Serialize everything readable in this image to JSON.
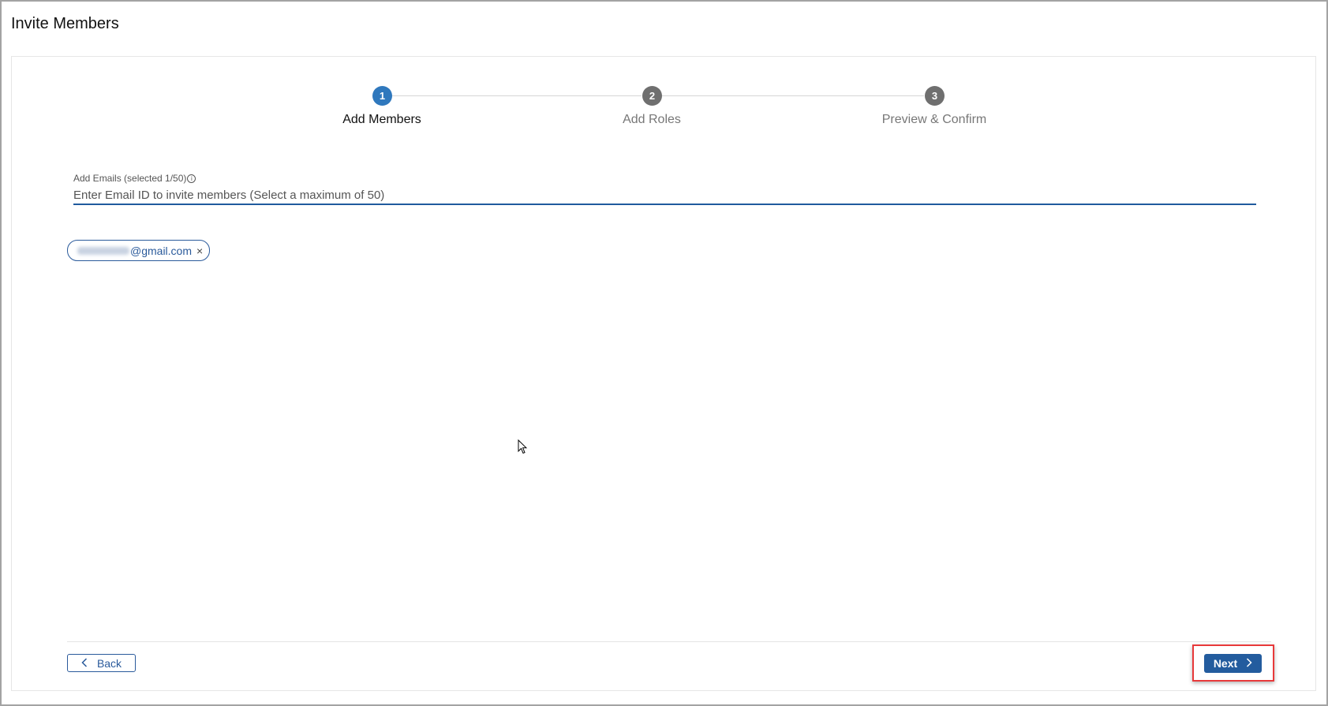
{
  "header": {
    "title": "Invite Members"
  },
  "stepper": {
    "steps": [
      {
        "number": "1",
        "label": "Add Members",
        "state": "active"
      },
      {
        "number": "2",
        "label": "Add Roles",
        "state": "inactive"
      },
      {
        "number": "3",
        "label": "Preview & Confirm",
        "state": "inactive"
      }
    ],
    "active_color": "#2f78bd",
    "inactive_color": "#6f6f6f"
  },
  "email_field": {
    "label": "Add Emails (selected 1/50)",
    "info_icon": "i",
    "placeholder": "Enter Email ID to invite members (Select a maximum of 50)",
    "value": ""
  },
  "chips": [
    {
      "email_visible": "@gmail.com",
      "remove": "×"
    }
  ],
  "footer": {
    "back_label": "Back",
    "next_label": "Next",
    "back_icon": "‹",
    "next_icon": "›"
  },
  "colors": {
    "primary": "#235c9e",
    "highlight": "#e8393a"
  }
}
